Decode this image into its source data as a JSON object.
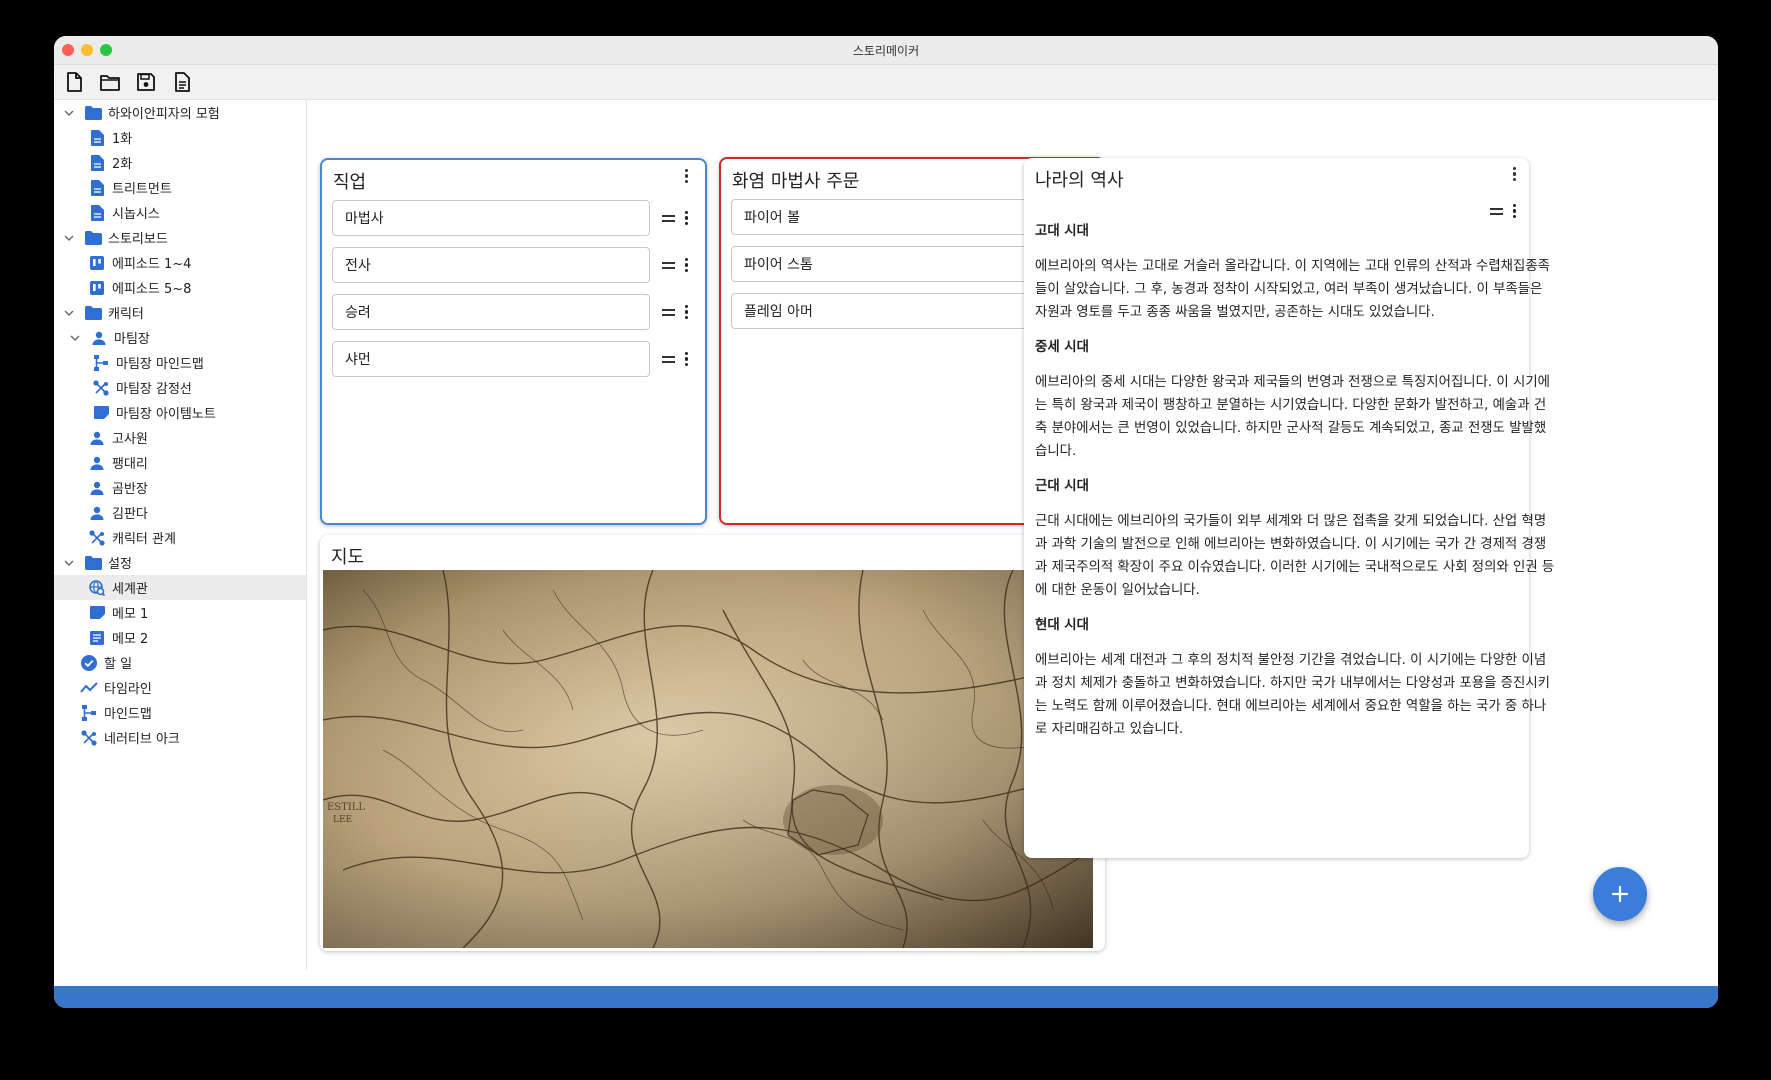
{
  "window": {
    "title": "스토리메이커"
  },
  "toolbar": {
    "buttons": [
      {
        "icon": "new-file-icon"
      },
      {
        "icon": "open-folder-icon"
      },
      {
        "icon": "save-icon"
      },
      {
        "icon": "document-icon"
      }
    ]
  },
  "sidebar": {
    "items": [
      {
        "label": "하와이안피자의 모험",
        "icon": "folder-icon",
        "level": 0,
        "expanded": true
      },
      {
        "label": "1화",
        "icon": "document-icon",
        "level": 1
      },
      {
        "label": "2화",
        "icon": "document-icon",
        "level": 1
      },
      {
        "label": "트리트먼트",
        "icon": "document-icon",
        "level": 1
      },
      {
        "label": "시놉시스",
        "icon": "document-icon",
        "level": 1
      },
      {
        "label": "스토리보드",
        "icon": "folder-icon",
        "level": 0,
        "expanded": true
      },
      {
        "label": "에피소드 1~4",
        "icon": "kanban-icon",
        "level": 1
      },
      {
        "label": "에피소드 5~8",
        "icon": "kanban-icon",
        "level": 1
      },
      {
        "label": "캐릭터",
        "icon": "folder-icon",
        "level": 0,
        "expanded": true
      },
      {
        "label": "마팀장",
        "icon": "person-icon",
        "level": 1,
        "expanded": true
      },
      {
        "label": "마팀장 마인드맵",
        "icon": "mindmap-icon",
        "level": 2
      },
      {
        "label": "마팀장 감정선",
        "icon": "arc-icon",
        "level": 2
      },
      {
        "label": "마팀장 아이템노트",
        "icon": "note-icon",
        "level": 2
      },
      {
        "label": "고사원",
        "icon": "person-icon",
        "level": 1
      },
      {
        "label": "팽대리",
        "icon": "person-icon",
        "level": 1
      },
      {
        "label": "곰반장",
        "icon": "person-icon",
        "level": 1
      },
      {
        "label": "김판다",
        "icon": "person-icon",
        "level": 1
      },
      {
        "label": "캐릭터 관계",
        "icon": "arc-icon",
        "level": 1
      },
      {
        "label": "설정",
        "icon": "folder-icon",
        "level": 0,
        "expanded": true
      },
      {
        "label": "세계관",
        "icon": "world-icon",
        "level": 1,
        "selected": true
      },
      {
        "label": "메모 1",
        "icon": "note-icon",
        "level": 1
      },
      {
        "label": "메모 2",
        "icon": "memo-icon",
        "level": 1
      },
      {
        "label": "할 일",
        "icon": "check-circle-icon",
        "level": 0
      },
      {
        "label": "타임라인",
        "icon": "timeline-icon",
        "level": 0
      },
      {
        "label": "마인드맵",
        "icon": "mindmap-icon",
        "level": 0
      },
      {
        "label": "네러티브 아크",
        "icon": "arc-icon",
        "level": 0
      }
    ]
  },
  "panels": {
    "jobs": {
      "title": "직업",
      "items": [
        "마법사",
        "전사",
        "승려",
        "샤먼"
      ],
      "border_color": "#4a86d8"
    },
    "spells": {
      "title": "화염 마법사 주문",
      "items": [
        "파이어 볼",
        "파이어 스톰",
        "플레임 아머"
      ],
      "border_color": "#cc2b2b"
    },
    "map": {
      "title": "지도"
    },
    "history": {
      "title": "나라의 역사",
      "sections": [
        {
          "heading": "고대 시대",
          "body": "에브리아의 역사는 고대로 거슬러 올라갑니다. 이 지역에는 고대 인류의 산적과 수렵채집종족들이 살았습니다. 그 후, 농경과 정착이 시작되었고, 여러 부족이 생겨났습니다. 이 부족들은 자원과 영토를 두고 종종 싸움을 벌였지만, 공존하는 시대도 있었습니다."
        },
        {
          "heading": "중세 시대",
          "body": "에브리아의 중세 시대는 다양한 왕국과 제국들의 번영과 전쟁으로 특징지어집니다. 이 시기에는 특히 왕국과 제국이 팽창하고 분열하는 시기였습니다. 다양한 문화가 발전하고, 예술과 건축 분야에서는 큰 번영이 있었습니다. 하지만 군사적 갈등도 계속되었고, 종교 전쟁도 발발했습니다."
        },
        {
          "heading": "근대 시대",
          "body": "근대 시대에는 에브리아의 국가들이 외부 세계와 더 많은 접촉을 갖게 되었습니다. 산업 혁명과 과학 기술의 발전으로 인해 에브리아는 변화하였습니다. 이 시기에는 국가 간 경제적 경쟁과 제국주의적 확장이 주요 이슈였습니다. 이러한 시기에는 국내적으로도 사회 정의와 인권 등에 대한 운동이 일어났습니다."
        },
        {
          "heading": "현대 시대",
          "body": "에브리아는 세계 대전과 그 후의 정치적 불안정 기간을 겪었습니다. 이 시기에는 다양한 이념과 정치 체제가 충돌하고 변화하였습니다. 하지만 국가 내부에서는 다양성과 포용을 증진시키는 노력도 함께 이루어졌습니다. 현대 에브리아는 세계에서 중요한 역할을 하는 국가 중 하나로 자리매김하고 있습니다."
        }
      ]
    }
  },
  "fab": {
    "icon": "plus-icon"
  },
  "colors": {
    "accent": "#3a7ddb",
    "folder": "#2f6fd1",
    "statusbar": "#3776c9"
  }
}
